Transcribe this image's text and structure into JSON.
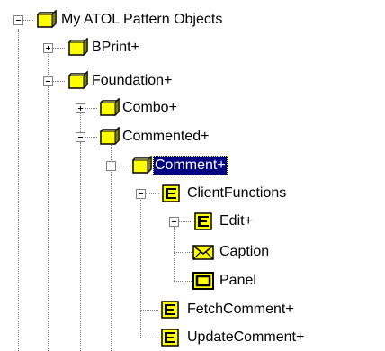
{
  "tree": {
    "root": {
      "label": "My ATOL Pattern Objects",
      "expanded": true
    },
    "bprint": {
      "label": "BPrint+",
      "expanded": false
    },
    "foundation": {
      "label": "Foundation+",
      "expanded": true
    },
    "combo": {
      "label": "Combo+",
      "expanded": false
    },
    "commented": {
      "label": "Commented+",
      "expanded": true
    },
    "comment": {
      "label": "Comment+",
      "expanded": true,
      "selected": true
    },
    "client_functions": {
      "label": "ClientFunctions",
      "expanded": true
    },
    "edit": {
      "label": "Edit+",
      "expanded": true
    },
    "caption": {
      "label": "Caption"
    },
    "panel": {
      "label": "Panel"
    },
    "fetch_comment": {
      "label": "FetchComment+"
    },
    "update_comment": {
      "label": "UpdateComment+"
    }
  },
  "colors": {
    "folder_fill": "#ffff00",
    "folder_shadow": "#808000",
    "selection_bg": "#000080",
    "selection_text": "#ffffff",
    "dotted_line": "#808080"
  },
  "icons": {
    "folder": "folder-icon",
    "function_group": "function-list-icon",
    "caption": "envelope-icon",
    "panel": "panel-icon"
  }
}
